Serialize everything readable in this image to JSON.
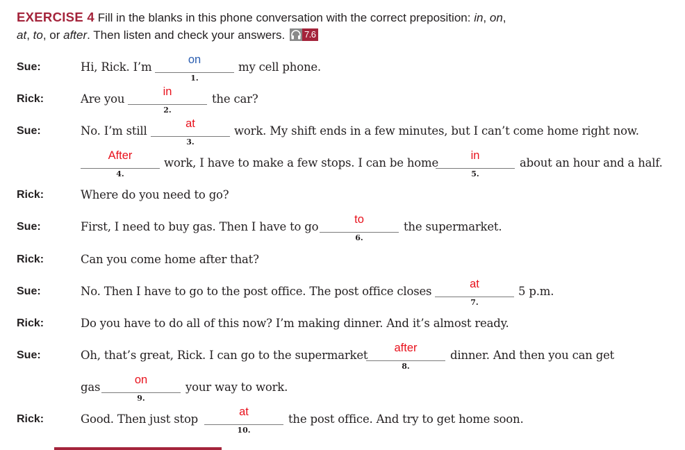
{
  "header": {
    "exercise_label": "EXERCISE 4",
    "instr_1": "Fill in the blanks in this phone conversation with the correct preposition: ",
    "p_in": "in",
    "comma_1": ", ",
    "p_on": "on",
    "comma_2": ",",
    "p_at": "at",
    "comma_3": ", ",
    "p_to": "to",
    "comma_4": ", or ",
    "p_after": "after",
    "instr_2": ". Then listen and check your answers.",
    "audio_icon": "headphones-icon",
    "audio_track": "7.6"
  },
  "colors": {
    "accent": "#a4243b",
    "answer_red": "#e8111c",
    "answer_blue": "#2a5db0"
  },
  "lines": [
    {
      "speaker": "Sue:",
      "t1": "Hi, Rick. I’m",
      "answer": "on",
      "num": "1.",
      "t2": "my cell phone."
    },
    {
      "speaker": "Rick:",
      "t1": "Are you",
      "answer": "in",
      "num": "2.",
      "t2": "the car?"
    },
    {
      "speaker": "Sue:",
      "t1": "No. I’m still",
      "answer": "at",
      "num": "3.",
      "t2": "work. My shift ends in a few minutes, but I can’t come home right now."
    },
    {
      "speaker": "",
      "answer_a": "After",
      "num_a": "4.",
      "t1": "work, I have to make a few stops. I can be home",
      "answer_b": "in",
      "num_b": "5.",
      "t2": "about an hour and a half."
    },
    {
      "speaker": "Rick:",
      "t1": "Where do you need to go?"
    },
    {
      "speaker": "Sue:",
      "t1": "First, I need to buy gas. Then I have to go",
      "answer": "to",
      "num": "6.",
      "t2": "the supermarket."
    },
    {
      "speaker": "Rick:",
      "t1": "Can you come home after that?"
    },
    {
      "speaker": "Sue:",
      "t1": "No. Then I have to go to the post office. The post office closes",
      "answer": "at",
      "num": "7.",
      "t2": "5 p.m."
    },
    {
      "speaker": "Rick:",
      "t1": "Do you have to do all of this now? I’m making dinner. And it’s almost ready."
    },
    {
      "speaker": "Sue:",
      "t1": "Oh, that’s great, Rick. I can go to the supermarket",
      "answer": "after",
      "num": "8.",
      "t2": "dinner. And then you can get"
    },
    {
      "speaker": "",
      "t1": "gas",
      "answer": "on",
      "num": "9.",
      "t2": "your way to work."
    },
    {
      "speaker": "Rick:",
      "t1": "Good. Then just stop",
      "answer": "at",
      "num": "10.",
      "t2": "the post office. And try to get home soon."
    }
  ]
}
